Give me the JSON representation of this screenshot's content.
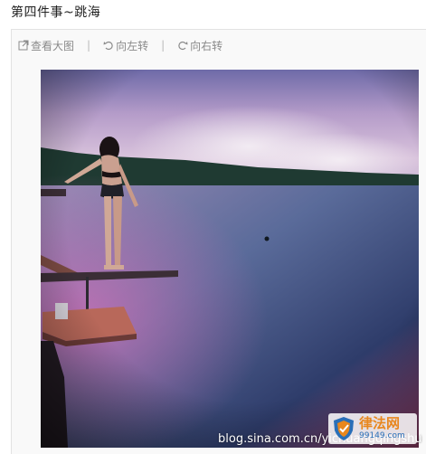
{
  "post": {
    "title": "第四件事~跳海"
  },
  "toolbar": {
    "view_large": "查看大图",
    "rotate_left": "向左转",
    "rotate_right": "向右转",
    "separator": "|"
  },
  "watermark": {
    "text": "blog.sina.com.cn/yichuangqingshu"
  },
  "logo": {
    "name": "律法网",
    "sub": "99149.com"
  },
  "colors": {
    "toolbar_text": "#8a8a8a",
    "logo_orange": "#e8871e",
    "logo_blue": "#2a6fb8"
  }
}
